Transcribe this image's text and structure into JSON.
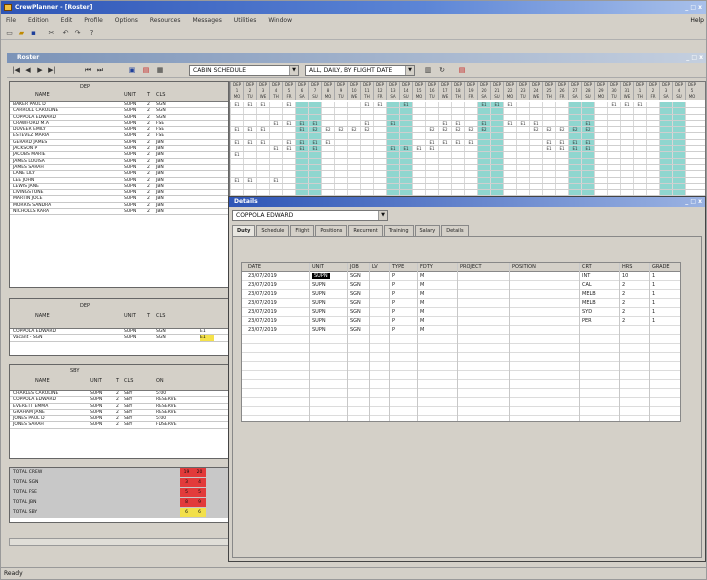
{
  "app": {
    "title": "CrewPlanner - [Roster]",
    "win_buttons": "_ □ x",
    "menu": [
      "File",
      "Edition",
      "Edit",
      "Profile",
      "Options",
      "Resources",
      "Messages",
      "Utilities",
      "Window"
    ],
    "menu_right": "Help"
  },
  "mdi": {
    "title": "Roster",
    "buttons": "_ □ x"
  },
  "nav": {
    "buttons": [
      "|◀",
      "◀",
      "▶",
      "▶|",
      "⏮",
      "⏭"
    ],
    "combo1": "CABIN SCHEDULE",
    "combo2": "ALL, DAILY, BY FLIGHT DATE"
  },
  "top_panel": {
    "header_label": "DEP",
    "cols": [
      "NAME",
      "UNIT",
      "T",
      "CLS"
    ],
    "rows": [
      {
        "name": "BAKER PAUL D",
        "unit": "SUPN",
        "t": "2",
        "cls": "SGN"
      },
      {
        "name": "CARROLL CAROLINE",
        "unit": "SUPN",
        "t": "2",
        "cls": "SGN"
      },
      {
        "name": "COPPOLA EDWARD",
        "unit": "SUPN",
        "t": "2",
        "cls": "SGN"
      },
      {
        "name": "CRAWFORD M.A",
        "unit": "SUPN",
        "t": "2",
        "cls": "FSE"
      },
      {
        "name": "DUVEER EMILY",
        "unit": "SUPN",
        "t": "2",
        "cls": "FSE"
      },
      {
        "name": "ESTEVEZ MARIA",
        "unit": "SUPN",
        "t": "2",
        "cls": "FSE"
      },
      {
        "name": "GERARD JAMES",
        "unit": "SUPN",
        "t": "2",
        "cls": "JBN"
      },
      {
        "name": "JACKSON P",
        "unit": "SUPN",
        "t": "2",
        "cls": "JBN"
      },
      {
        "name": "JACOBS MARIE",
        "unit": "SUPN",
        "t": "2",
        "cls": "JBN"
      },
      {
        "name": "JAMES LOUISA",
        "unit": "SUPN",
        "t": "2",
        "cls": "JBN"
      },
      {
        "name": "JAMES SARAH",
        "unit": "SUPN",
        "t": "2",
        "cls": "JBN"
      },
      {
        "name": "LANE LILY",
        "unit": "SUPN",
        "t": "2",
        "cls": "JBN"
      },
      {
        "name": "LEE JOHN",
        "unit": "SUPN",
        "t": "2",
        "cls": "JBN"
      },
      {
        "name": "LEWIS JANE",
        "unit": "SUPN",
        "t": "2",
        "cls": "JBN"
      },
      {
        "name": "LIVINGSTONE",
        "unit": "SUPN",
        "t": "2",
        "cls": "JBN"
      },
      {
        "name": "MARTIN JOCE",
        "unit": "SUPN",
        "t": "2",
        "cls": "JBN"
      },
      {
        "name": "MORRIS SANDRA",
        "unit": "SUPN",
        "t": "2",
        "cls": "JBN"
      },
      {
        "name": "NICHOLLS KARA",
        "unit": "SUPN",
        "t": "2",
        "cls": "JBN"
      }
    ]
  },
  "mid_panel": {
    "header_label": "DEP",
    "cols": [
      "NAME",
      "UNIT",
      "T",
      "CLS"
    ],
    "rows": [
      {
        "name": "COPPOLA EDWARD",
        "unit": "SUPN",
        "t": "",
        "cls": "SGN"
      },
      {
        "name": "Vacant - SGN",
        "unit": "SUPN",
        "t": "",
        "cls": "SGN"
      }
    ]
  },
  "low_panel": {
    "header_label": "SBY",
    "cols": [
      "NAME",
      "UNIT",
      "T",
      "CLS",
      "ON"
    ],
    "rows": [
      {
        "name": "CHARLES CAROLINE",
        "unit": "SUPN",
        "t": "2",
        "cls": "SBY",
        "on": "5:00"
      },
      {
        "name": "COPPOLA EDWARD",
        "unit": "SUPN",
        "t": "2",
        "cls": "SBY",
        "on": "RESERVE"
      },
      {
        "name": "EVERETT EMMA",
        "unit": "SUPN",
        "t": "2",
        "cls": "SBY",
        "on": "RESERVE"
      },
      {
        "name": "GRAHAM JANE",
        "unit": "SUPN",
        "t": "2",
        "cls": "SBY",
        "on": "RESERVE"
      },
      {
        "name": "JONES PAUL D",
        "unit": "SUPN",
        "t": "2",
        "cls": "SBY",
        "on": "5:00"
      },
      {
        "name": "JONES SARAH",
        "unit": "SUPN",
        "t": "2",
        "cls": "SBY",
        "on": "FDSERVE"
      }
    ]
  },
  "bottom_panel": {
    "rows": [
      "TOTAL CREW",
      "TOTAL SGN",
      "TOTAL FSE",
      "TOTAL JBN",
      "TOTAL SBY"
    ]
  },
  "grid": {
    "hdr1": [
      "DEP",
      "DEP",
      "DEP",
      "DEP",
      "DEP",
      "DEP",
      "DEP",
      "DEP",
      "DEP",
      "DEP",
      "DEP",
      "DEP",
      "DEP",
      "DEP",
      "DEP",
      "DEP",
      "DEP",
      "DEP",
      "DEP",
      "DEP",
      "DEP",
      "DEP",
      "DEP",
      "DEP",
      "DEP",
      "DEP",
      "DEP",
      "DEP",
      "DEP",
      "DEP",
      "DEP",
      "DEP",
      "DEP",
      "DEP",
      "DEP",
      "DEP"
    ],
    "hdr2": [
      "1",
      "2",
      "3",
      "4",
      "5",
      "6",
      "7",
      "8",
      "9",
      "10",
      "11",
      "12",
      "13",
      "14",
      "15",
      "16",
      "17",
      "18",
      "19",
      "20",
      "21",
      "22",
      "23",
      "24",
      "25",
      "26",
      "27",
      "28",
      "29",
      "30",
      "31",
      "1",
      "2",
      "3",
      "4",
      "5"
    ],
    "hdr3": [
      "MO",
      "TU",
      "WE",
      "TH",
      "FR",
      "SA",
      "SU",
      "MO",
      "TU",
      "WE",
      "TH",
      "FR",
      "SA",
      "SU",
      "MO",
      "TU",
      "WE",
      "TH",
      "FR",
      "SA",
      "SU",
      "MO",
      "TU",
      "WE",
      "TH",
      "FR",
      "SA",
      "SU",
      "MO",
      "TU",
      "WE",
      "TH",
      "FR",
      "SA",
      "SU",
      "MO"
    ],
    "rows": [
      [
        "E1",
        "E1",
        "E1",
        "",
        "E1",
        "",
        "",
        "",
        "",
        "",
        "E1",
        "E1",
        "",
        "E1",
        "",
        "",
        "",
        "",
        "",
        "E1",
        "E1",
        "E1",
        "",
        "",
        "",
        "",
        "",
        "",
        "",
        "E1",
        "E1",
        "E1",
        "",
        "",
        "",
        ""
      ],
      [
        "",
        "",
        "",
        "",
        "",
        "",
        "",
        "",
        "",
        "",
        "",
        "",
        "",
        "",
        "",
        "",
        "",
        "",
        "",
        "",
        "",
        "",
        "",
        "",
        "",
        "",
        "",
        "",
        "",
        "",
        "",
        "",
        "",
        "",
        "",
        ""
      ],
      [
        "",
        "",
        "",
        "",
        "",
        "",
        "",
        "",
        "",
        "",
        "",
        "",
        "",
        "",
        "",
        "",
        "",
        "",
        "",
        "",
        "",
        "",
        "",
        "",
        "",
        "",
        "",
        "",
        "",
        "",
        "",
        "",
        "",
        "",
        "",
        ""
      ],
      [
        "",
        "",
        "",
        "E1",
        "E1",
        "E1",
        "E1",
        "",
        "",
        "",
        "E1",
        "",
        "E1",
        "",
        "",
        "",
        "E1",
        "E1",
        "",
        "E1",
        "",
        "E1",
        "E1",
        "E1",
        "",
        "",
        "",
        "E1",
        "",
        "",
        "",
        "",
        "",
        "",
        "",
        ""
      ],
      [
        "E1",
        "E1",
        "E1",
        "",
        "",
        "E1",
        "E2",
        "E2",
        "E2",
        "E2",
        "E2",
        "",
        "",
        "",
        "",
        "E2",
        "E2",
        "E2",
        "E2",
        "E2",
        "",
        "",
        "",
        "E2",
        "E2",
        "E2",
        "E2",
        "E2",
        "",
        "",
        "",
        "",
        "",
        "",
        "",
        ""
      ],
      [
        "",
        "",
        "",
        "",
        "",
        "",
        "",
        "",
        "",
        "",
        "",
        "",
        "",
        "",
        "",
        "",
        "",
        "",
        "",
        "",
        "",
        "",
        "",
        "",
        "",
        "",
        "",
        "",
        "",
        "",
        "",
        "",
        "",
        "",
        "",
        ""
      ],
      [
        "E1",
        "E1",
        "E1",
        "",
        "E1",
        "E1",
        "E1",
        "E1",
        "",
        "",
        "",
        "",
        "",
        "",
        "",
        "E1",
        "E1",
        "E1",
        "E1",
        "",
        "",
        "",
        "",
        "",
        "E1",
        "E1",
        "E1",
        "E1",
        "",
        "",
        "",
        "",
        "",
        "",
        "",
        ""
      ],
      [
        "",
        "",
        "",
        "E1",
        "E1",
        "E1",
        "E1",
        "",
        "",
        "",
        "",
        "",
        "E1",
        "E1",
        "E1",
        "E1",
        "",
        "",
        "",
        "",
        "",
        "",
        "",
        "",
        "E1",
        "E1",
        "E1",
        "E1",
        "",
        "",
        "",
        "",
        "",
        "",
        "",
        ""
      ],
      [
        "E1",
        "",
        "",
        "",
        "",
        "",
        "",
        "",
        "",
        "",
        "",
        "",
        "",
        "",
        "",
        "",
        "",
        "",
        "",
        "",
        "",
        "",
        "",
        "",
        "",
        "",
        "",
        "",
        "",
        "",
        "",
        "",
        "",
        "",
        "",
        ""
      ],
      [
        "",
        "",
        "",
        "",
        "",
        "",
        "",
        "",
        "",
        "",
        "",
        "",
        "",
        "",
        "",
        "",
        "",
        "",
        "",
        "",
        "",
        "",
        "",
        "",
        "",
        "",
        "",
        "",
        "",
        "",
        "",
        "",
        "",
        "",
        "",
        ""
      ],
      [
        "",
        "",
        "",
        "",
        "",
        "",
        "",
        "",
        "",
        "",
        "",
        "",
        "",
        "",
        "",
        "",
        "",
        "",
        "",
        "",
        "",
        "",
        "",
        "",
        "",
        "",
        "",
        "",
        "",
        "",
        "",
        "",
        "",
        "",
        "",
        ""
      ],
      [
        "",
        "",
        "",
        "",
        "",
        "",
        "",
        "",
        "",
        "",
        "",
        "",
        "",
        "",
        "",
        "",
        "",
        "",
        "",
        "",
        "",
        "",
        "",
        "",
        "",
        "",
        "",
        "",
        "",
        "",
        "",
        "",
        "",
        "",
        "",
        ""
      ],
      [
        "E1",
        "E1",
        "",
        "E1",
        "",
        "",
        "",
        "",
        "",
        "",
        "",
        "",
        "",
        "",
        "",
        "",
        "",
        "",
        "",
        "",
        "",
        "",
        "",
        "",
        "",
        "",
        "",
        "",
        "",
        "",
        "",
        "",
        "",
        "",
        "",
        ""
      ],
      [
        "",
        "",
        "",
        "",
        "",
        "",
        "",
        "",
        "",
        "",
        "",
        "",
        "",
        "",
        "",
        "",
        "",
        "",
        "",
        "",
        "",
        "",
        "",
        "",
        "",
        "",
        "",
        "",
        "",
        "",
        "",
        "",
        "",
        "",
        "",
        ""
      ],
      [
        "",
        "",
        "",
        "",
        "",
        "",
        "",
        "",
        "",
        "",
        "",
        "",
        "",
        "",
        "",
        "",
        "",
        "",
        "",
        "",
        "",
        "",
        "",
        "",
        "",
        "",
        "",
        "",
        "",
        "",
        "",
        "",
        "",
        "",
        "",
        ""
      ],
      [
        "",
        "",
        "",
        "",
        "",
        "",
        "",
        "",
        "",
        "",
        "",
        "",
        "",
        "",
        "",
        "",
        "",
        "",
        "",
        "",
        "",
        "",
        "",
        "",
        "",
        "",
        "",
        "",
        "",
        "",
        "",
        "",
        "",
        "",
        "",
        ""
      ],
      [
        "",
        "",
        "",
        "",
        "",
        "",
        "",
        "",
        "",
        "",
        "",
        "",
        "",
        "",
        "",
        "",
        "",
        "",
        "",
        "",
        "",
        "",
        "",
        "",
        "",
        "",
        "",
        "",
        "",
        "",
        "",
        "",
        "",
        "",
        "",
        ""
      ],
      [
        "",
        "",
        "E1",
        "E1",
        "",
        "",
        "",
        "",
        "",
        "",
        "",
        "",
        "",
        "",
        "",
        "",
        "",
        "",
        "",
        "",
        "",
        "",
        "",
        "",
        "",
        "",
        "",
        "",
        "",
        "",
        "",
        "",
        "",
        "",
        "",
        ""
      ]
    ],
    "highlight_cols": [
      5,
      6,
      12,
      13,
      19,
      20,
      26,
      27,
      33,
      34
    ],
    "highlight_color": "#8fd6cf"
  },
  "mid_vals": [
    "E1",
    "E1"
  ],
  "low_vals": [
    "",
    "",
    "",
    "",
    "",
    ""
  ],
  "bottom_vals": [
    [
      "19",
      "20"
    ],
    [
      "3",
      "4"
    ],
    [
      "5",
      "5"
    ],
    [
      "8",
      "9"
    ],
    [
      "6",
      "6"
    ]
  ],
  "bottom_colors": [
    "#e23b3b",
    "#e23b3b",
    "#e23b3b",
    "#e23b3b",
    "#f2e04a"
  ],
  "yellow": "#f5e24a",
  "dialog": {
    "title": "Details",
    "win_buttons": "_ □ x",
    "combo": "COPPOLA EDWARD",
    "tabs": [
      "Duty",
      "Schedule",
      "Flight",
      "Positions",
      "Recurrent",
      "Training",
      "Salary",
      "Details"
    ],
    "cols": [
      "DATE",
      "UNIT",
      "JOB",
      "LV",
      "TYPE",
      "FDTY",
      "PROJECT",
      "POSITION",
      "CRT",
      "HRS",
      "GRADE"
    ],
    "rows": [
      [
        "23/07/2019",
        "SUPN",
        "SGN",
        "",
        "P",
        "M",
        "",
        "",
        "INT",
        "10",
        "1"
      ],
      [
        "23/07/2019",
        "SUPN",
        "SGN",
        "",
        "P",
        "M",
        "",
        "",
        "CAL",
        "2",
        "1"
      ],
      [
        "23/07/2019",
        "SUPN",
        "SGN",
        "",
        "P",
        "M",
        "",
        "",
        "MELB",
        "2",
        "1"
      ],
      [
        "23/07/2019",
        "SUPN",
        "SGN",
        "",
        "P",
        "M",
        "",
        "",
        "MELB",
        "2",
        "1"
      ],
      [
        "23/07/2019",
        "SUPN",
        "SGN",
        "",
        "P",
        "M",
        "",
        "",
        "SYD",
        "2",
        "1"
      ],
      [
        "23/07/2019",
        "SUPN",
        "SGN",
        "",
        "P",
        "M",
        "",
        "",
        "PER",
        "2",
        "1"
      ],
      [
        "23/07/2019",
        "SUPN",
        "SGN",
        "",
        "P",
        "M",
        "",
        "",
        "",
        "",
        ""
      ]
    ],
    "selected_cell": "SUPN"
  },
  "status": "Ready"
}
